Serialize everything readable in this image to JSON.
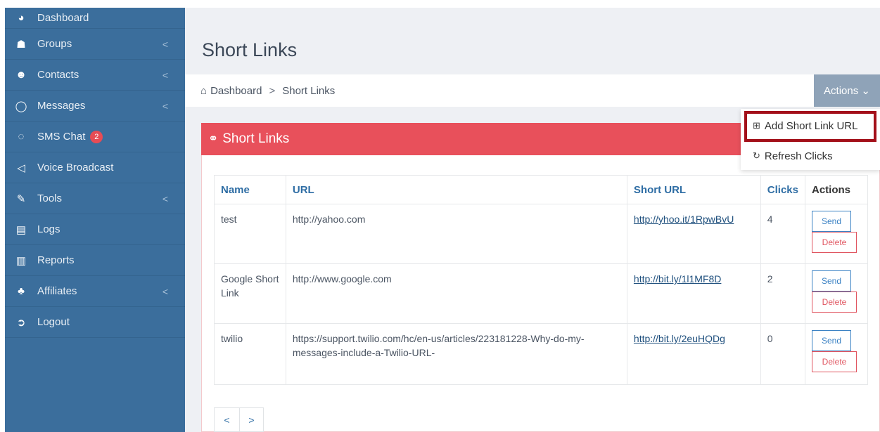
{
  "sidebar": {
    "items": [
      {
        "label": "Dashboard",
        "icon": "dashboard-icon",
        "glyph": "◕",
        "has_chevron": false
      },
      {
        "label": "Groups",
        "icon": "groups-icon",
        "glyph": "☗",
        "has_chevron": true
      },
      {
        "label": "Contacts",
        "icon": "contact-icon",
        "glyph": "☻",
        "has_chevron": true
      },
      {
        "label": "Messages",
        "icon": "speech-bubble-icon",
        "glyph": "◯",
        "has_chevron": true
      },
      {
        "label": "SMS Chat",
        "icon": "chat-icon",
        "glyph": "◌",
        "has_chevron": false,
        "badge": "2"
      },
      {
        "label": "Voice Broadcast",
        "icon": "megaphone-icon",
        "glyph": "◁",
        "has_chevron": false
      },
      {
        "label": "Tools",
        "icon": "wrench-icon",
        "glyph": "✎",
        "has_chevron": true
      },
      {
        "label": "Logs",
        "icon": "document-icon",
        "glyph": "▤",
        "has_chevron": false
      },
      {
        "label": "Reports",
        "icon": "bar-chart-icon",
        "glyph": "▥",
        "has_chevron": false
      },
      {
        "label": "Affiliates",
        "icon": "sitemap-icon",
        "glyph": "♣",
        "has_chevron": true
      },
      {
        "label": "Logout",
        "icon": "logout-icon",
        "glyph": "➲",
        "has_chevron": false
      }
    ],
    "chevron": "<"
  },
  "header": {
    "title": "Short Links",
    "breadcrumb": {
      "home": "Dashboard",
      "separator": ">",
      "current": "Short Links"
    },
    "actions_label": "Actions ⌄"
  },
  "dropdown": {
    "add_label": "Add Short Link URL",
    "add_glyph": "⊞",
    "refresh_label": "Refresh Clicks",
    "refresh_glyph": "↻"
  },
  "panel": {
    "title": "Short Links",
    "title_glyph": "⚭"
  },
  "table": {
    "columns": [
      "Name",
      "URL",
      "Short URL",
      "Clicks",
      "Actions"
    ],
    "rows": [
      {
        "name": "test",
        "url": "http://yahoo.com",
        "short_url": "http://yhoo.it/1RpwBvU",
        "clicks": "4"
      },
      {
        "name": "Google Short Link",
        "url": "http://www.google.com",
        "short_url": "http://bit.ly/1l1MF8D",
        "clicks": "2"
      },
      {
        "name": "twilio",
        "url": "https://support.twilio.com/hc/en-us/articles/223181228-Why-do-my-messages-include-a-Twilio-URL-",
        "short_url": "http://bit.ly/2euHQDg",
        "clicks": "0"
      }
    ],
    "send_label": "Send",
    "delete_label": "Delete"
  },
  "pagination": {
    "prev": "<",
    "next": ">"
  },
  "colors": {
    "sidebar": "#3b6e9c",
    "panel_header": "#e8505b",
    "link": "#2e6da4",
    "highlight": "#a3101a",
    "badge": "#e74c55"
  }
}
